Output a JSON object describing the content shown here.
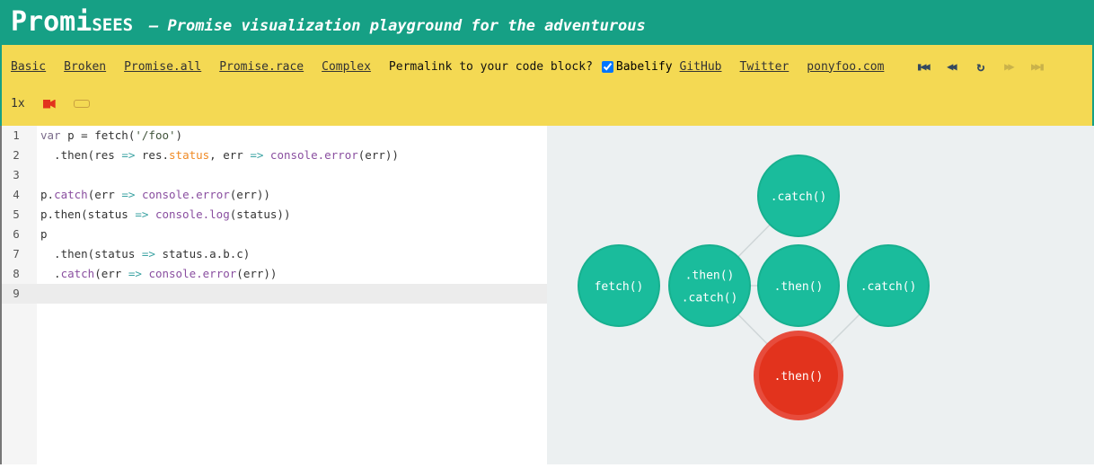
{
  "header": {
    "title_big": "Promi",
    "title_small": "SEES",
    "tagline": "— Promise visualization playground for the adventurous"
  },
  "toolbar": {
    "examples": [
      "Basic",
      "Broken",
      "Promise.all",
      "Promise.race",
      "Complex"
    ],
    "permalink": "Permalink to your code block?",
    "babelify": "Babelify",
    "babelify_checked": true,
    "links": [
      "GitHub",
      "Twitter",
      "ponyfoo.com"
    ],
    "controls": [
      {
        "name": "first",
        "glyph": "▮◀◀",
        "enabled": true
      },
      {
        "name": "back",
        "glyph": "◀◀",
        "enabled": true
      },
      {
        "name": "restart",
        "glyph": "↻",
        "enabled": true
      },
      {
        "name": "forward",
        "glyph": "▶▶",
        "enabled": false
      },
      {
        "name": "last",
        "glyph": "▶▶▮",
        "enabled": false
      }
    ],
    "speed": "1x"
  },
  "code": [
    [
      [
        "t-kw",
        "var"
      ],
      [
        "t-p",
        " p = fetch("
      ],
      [
        "t-str",
        "'/foo'"
      ],
      [
        "t-p",
        ")"
      ]
    ],
    [
      [
        "t-p",
        "  .then(res "
      ],
      [
        "t-op",
        "=>"
      ],
      [
        "t-p",
        " res."
      ],
      [
        "t-prop",
        "status"
      ],
      [
        "t-p",
        ", err "
      ],
      [
        "t-op",
        "=>"
      ],
      [
        "t-p",
        " "
      ],
      [
        "t-fn",
        "console.error"
      ],
      [
        "t-p",
        "(err))"
      ]
    ],
    [],
    [
      [
        "t-p",
        "p."
      ],
      [
        "t-fn",
        "catch"
      ],
      [
        "t-p",
        "(err "
      ],
      [
        "t-op",
        "=>"
      ],
      [
        "t-p",
        " "
      ],
      [
        "t-fn",
        "console.error"
      ],
      [
        "t-p",
        "(err))"
      ]
    ],
    [
      [
        "t-p",
        "p.then(status "
      ],
      [
        "t-op",
        "=>"
      ],
      [
        "t-p",
        " "
      ],
      [
        "t-fn",
        "console.log"
      ],
      [
        "t-p",
        "(status))"
      ]
    ],
    [
      [
        "t-p",
        "p"
      ]
    ],
    [
      [
        "t-p",
        "  .then(status "
      ],
      [
        "t-op",
        "=>"
      ],
      [
        "t-p",
        " status.a.b.c)"
      ]
    ],
    [
      [
        "t-p",
        "  ."
      ],
      [
        "t-fn",
        "catch"
      ],
      [
        "t-p",
        "(err "
      ],
      [
        "t-op",
        "=>"
      ],
      [
        "t-p",
        " "
      ],
      [
        "t-fn",
        "console.error"
      ],
      [
        "t-p",
        "(err))"
      ]
    ],
    []
  ],
  "graph": {
    "colors": {
      "ok": "#1abc9c",
      "okBorder": "#17b08f",
      "rejected": "#e2331d",
      "rejectedBorder": "#e74c3c",
      "edge": "#cfd6d8"
    },
    "nodes": [
      {
        "id": "fetch",
        "labels": [
          "fetch()"
        ],
        "state": "ok"
      },
      {
        "id": "thencatch",
        "labels": [
          ".then()",
          ".catch()"
        ],
        "state": "ok"
      },
      {
        "id": "then1",
        "labels": [
          ".then()"
        ],
        "state": "ok"
      },
      {
        "id": "catch1",
        "labels": [
          ".catch()"
        ],
        "state": "ok"
      },
      {
        "id": "catchTop",
        "labels": [
          ".catch()"
        ],
        "state": "ok"
      },
      {
        "id": "thenRed",
        "labels": [
          ".then()"
        ],
        "state": "rejected"
      }
    ]
  }
}
